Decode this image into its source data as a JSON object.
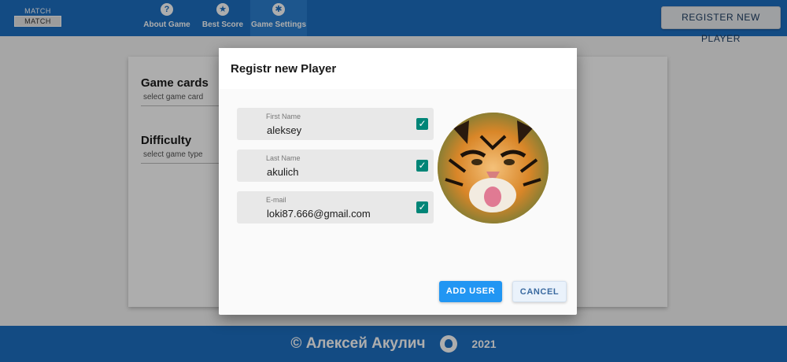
{
  "header": {
    "logo_top": "MATCH",
    "logo_bottom": "MATCH",
    "nav": [
      {
        "label": "About Game",
        "icon": "question-icon"
      },
      {
        "label": "Best Score",
        "icon": "star-icon"
      },
      {
        "label": "Game Settings",
        "icon": "gear-icon"
      }
    ],
    "register_button": "REGISTER NEW PLAYER"
  },
  "settings": {
    "game_cards": {
      "title": "Game cards",
      "subtitle": "select game card"
    },
    "difficulty": {
      "title": "Difficulty",
      "subtitle": "select game type"
    }
  },
  "modal": {
    "title": "Registr new Player",
    "fields": [
      {
        "label": "First Name",
        "value": "aleksey",
        "valid": true
      },
      {
        "label": "Last Name",
        "value": "akulich",
        "valid": true
      },
      {
        "label": "E-mail",
        "value": "loki87.666@gmail.com",
        "valid": true
      }
    ],
    "avatar": "tiger-photo",
    "add_button": "ADD USER",
    "cancel_button": "CANCEL"
  },
  "footer": {
    "author": "© Алексей Акулич",
    "icon": "github-icon",
    "year": "2021"
  },
  "colors": {
    "header_bg": "#1d6fc2",
    "primary_button": "#2196f3",
    "checkbox": "#008577"
  }
}
